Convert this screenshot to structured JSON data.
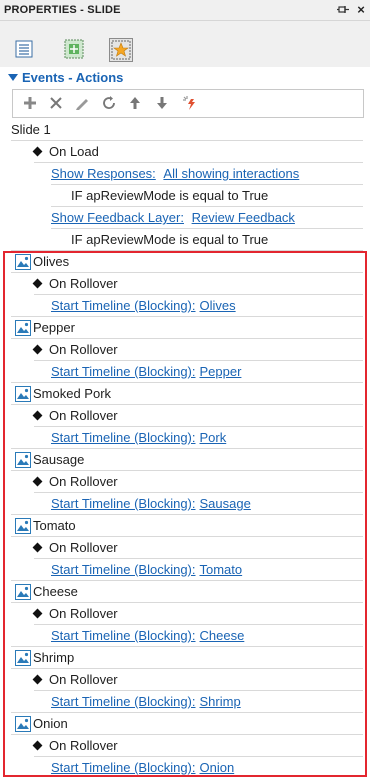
{
  "panel": {
    "title": "PROPERTIES - SLIDE",
    "pin_icon": "pin-icon",
    "close_label": "×"
  },
  "tabs": [
    {
      "name": "properties-tab",
      "icon": "list-icon"
    },
    {
      "name": "style-tab",
      "icon": "move-icon"
    },
    {
      "name": "actions-tab",
      "icon": "star-icon",
      "active": true
    }
  ],
  "section": {
    "title": "Events - Actions"
  },
  "action_toolbar": {
    "buttons": [
      "add-icon",
      "delete-icon",
      "edit-icon",
      "refresh-icon",
      "move-up-icon",
      "move-down-icon",
      "magic-icon"
    ]
  },
  "slide": {
    "name": "Slide 1",
    "event": "On Load",
    "actions": [
      {
        "link": "Show Responses:",
        "target": "All showing interactions",
        "condition": "IF apReviewMode is equal to True"
      },
      {
        "link": "Show Feedback Layer:",
        "target": "Review Feedback",
        "condition": "IF apReviewMode is equal to True"
      }
    ]
  },
  "objects": [
    {
      "name": "Olives",
      "event": "On Rollover",
      "action": "Start Timeline (Blocking):",
      "target": "Olives"
    },
    {
      "name": "Pepper",
      "event": "On Rollover",
      "action": "Start Timeline (Blocking):",
      "target": "Pepper"
    },
    {
      "name": "Smoked Pork",
      "event": "On Rollover",
      "action": "Start Timeline (Blocking):",
      "target": "Pork"
    },
    {
      "name": "Sausage",
      "event": "On Rollover",
      "action": "Start Timeline (Blocking):",
      "target": "Sausage"
    },
    {
      "name": "Tomato",
      "event": "On Rollover",
      "action": "Start Timeline (Blocking):",
      "target": "Tomato"
    },
    {
      "name": "Cheese",
      "event": "On Rollover",
      "action": "Start Timeline (Blocking):",
      "target": "Cheese"
    },
    {
      "name": "Shrimp",
      "event": "On Rollover",
      "action": "Start Timeline (Blocking):",
      "target": "Shrimp"
    },
    {
      "name": "Onion",
      "event": "On Rollover",
      "action": "Start Timeline (Blocking):",
      "target": "Onion"
    }
  ],
  "colors": {
    "link": "#1a64b4",
    "highlight_border": "#e3262f",
    "image_icon": "#2a7ab8"
  }
}
